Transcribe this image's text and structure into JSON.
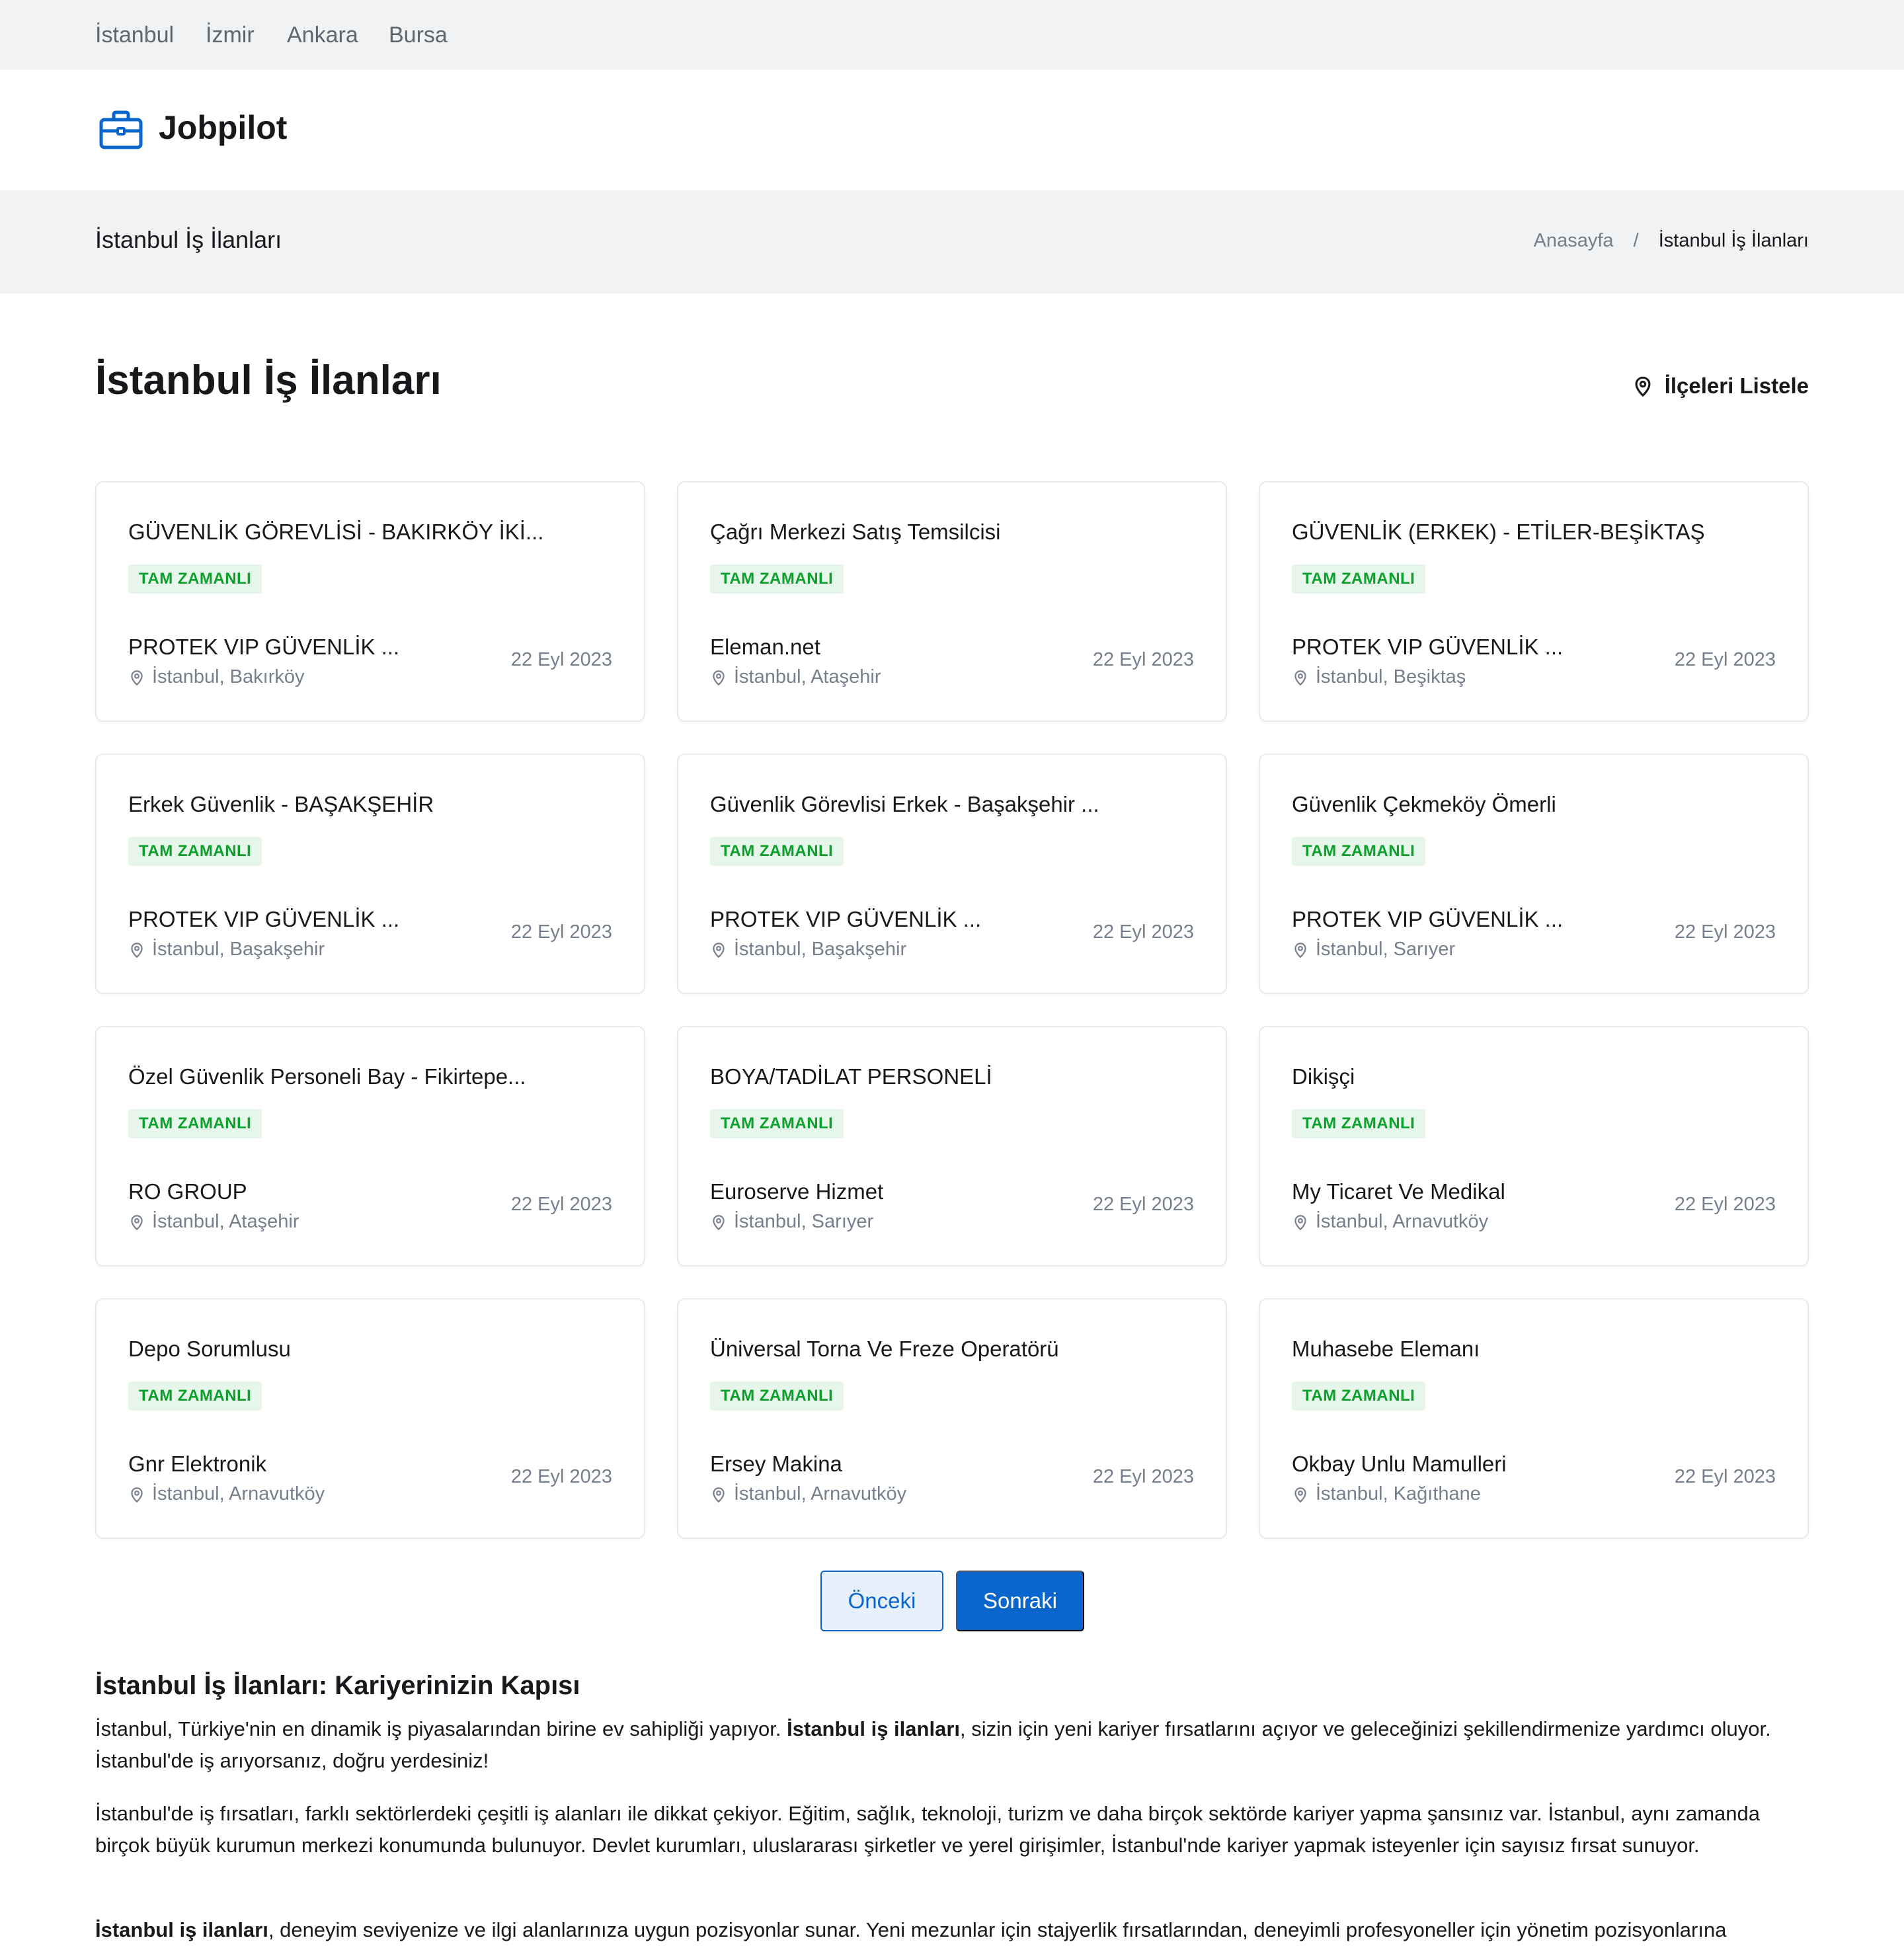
{
  "top_nav": {
    "cities": [
      "İstanbul",
      "İzmir",
      "Ankara",
      "Bursa"
    ]
  },
  "brand": {
    "name": "Jobpilot",
    "color": "#0a65cc",
    "icon": "briefcase-icon"
  },
  "breadcrumb": {
    "title": "İstanbul İş İlanları",
    "home": "Anasayfa",
    "separator": "/",
    "current": "İstanbul İş İlanları"
  },
  "main": {
    "title": "İstanbul İş İlanları",
    "districts_button": "İlçeleri Listele"
  },
  "jobs": [
    {
      "title": "GÜVENLİK GÖREVLİSİ - BAKIRKÖY İKİ...",
      "type": "TAM ZAMANLI",
      "company": "PROTEK VIP GÜVENLİK ...",
      "location": "İstanbul, Bakırköy",
      "date": "22 Eyl 2023"
    },
    {
      "title": "Çağrı Merkezi Satış Temsilcisi",
      "type": "TAM ZAMANLI",
      "company": "Eleman.net",
      "location": "İstanbul, Ataşehir",
      "date": "22 Eyl 2023"
    },
    {
      "title": "GÜVENLİK (ERKEK) - ETİLER-BEŞİKTAŞ",
      "type": "TAM ZAMANLI",
      "company": "PROTEK VIP GÜVENLİK ...",
      "location": "İstanbul, Beşiktaş",
      "date": "22 Eyl 2023"
    },
    {
      "title": "Erkek Güvenlik - BAŞAKŞEHİR",
      "type": "TAM ZAMANLI",
      "company": "PROTEK VIP GÜVENLİK ...",
      "location": "İstanbul, Başakşehir",
      "date": "22 Eyl 2023"
    },
    {
      "title": "Güvenlik Görevlisi Erkek - Başakşehir ...",
      "type": "TAM ZAMANLI",
      "company": "PROTEK VIP GÜVENLİK ...",
      "location": "İstanbul, Başakşehir",
      "date": "22 Eyl 2023"
    },
    {
      "title": "Güvenlik Çekmeköy Ömerli",
      "type": "TAM ZAMANLI",
      "company": "PROTEK VIP GÜVENLİK ...",
      "location": "İstanbul, Sarıyer",
      "date": "22 Eyl 2023"
    },
    {
      "title": "Özel Güvenlik Personeli Bay - Fikirtepe...",
      "type": "TAM ZAMANLI",
      "company": "RO GROUP",
      "location": "İstanbul, Ataşehir",
      "date": "22 Eyl 2023"
    },
    {
      "title": "BOYA/TADİLAT PERSONELİ",
      "type": "TAM ZAMANLI",
      "company": "Euroserve Hizmet",
      "location": "İstanbul, Sarıyer",
      "date": "22 Eyl 2023"
    },
    {
      "title": "Dikişçi",
      "type": "TAM ZAMANLI",
      "company": "My Ticaret Ve Medikal",
      "location": "İstanbul, Arnavutköy",
      "date": "22 Eyl 2023"
    },
    {
      "title": "Depo Sorumlusu",
      "type": "TAM ZAMANLI",
      "company": "Gnr Elektronik",
      "location": "İstanbul, Arnavutköy",
      "date": "22 Eyl 2023"
    },
    {
      "title": "Üniversal Torna Ve Freze Operatörü",
      "type": "TAM ZAMANLI",
      "company": "Ersey Makina",
      "location": "İstanbul, Arnavutköy",
      "date": "22 Eyl 2023"
    },
    {
      "title": "Muhasebe Elemanı",
      "type": "TAM ZAMANLI",
      "company": "Okbay Unlu Mamulleri",
      "location": "İstanbul, Kağıthane",
      "date": "22 Eyl 2023"
    }
  ],
  "pagination": {
    "prev": "Önceki",
    "next": "Sonraki"
  },
  "seo": {
    "title": "İstanbul İş İlanları: Kariyerinizin Kapısı",
    "p1_a": "İstanbul, Türkiye'nin en dinamik iş piyasalarından birine ev sahipliği yapıyor. ",
    "p1_b": "İstanbul iş ilanları",
    "p1_c": ", sizin için yeni kariyer fırsatlarını açıyor ve geleceğinizi şekillendirmenize yardımcı oluyor. İstanbul'de iş arıyorsanız, doğru yerdesiniz!",
    "p2": "İstanbul'de iş fırsatları, farklı sektörlerdeki çeşitli iş alanları ile dikkat çekiyor. Eğitim, sağlık, teknoloji, turizm ve daha birçok sektörde kariyer yapma şansınız var. İstanbul, aynı zamanda birçok büyük kurumun merkezi konumunda bulunuyor. Devlet kurumları, uluslararası şirketler ve yerel girişimler, İstanbul'nde kariyer yapmak isteyenler için sayısız fırsat sunuyor.",
    "p3_a": "İstanbul iş ilanları",
    "p3_b": ", deneyim seviyenize ve ilgi alanlarınıza uygun pozisyonlar sunar. Yeni mezunlar için stajyerlik fırsatlarından, deneyimli profesyoneller için yönetim pozisyonlarına"
  },
  "colors": {
    "accent": "#0a65cc",
    "badge_bg": "#e7f6ea",
    "badge_text": "#0ba02c",
    "muted": "#767f8c",
    "bar_bg": "#f1f2f4"
  }
}
